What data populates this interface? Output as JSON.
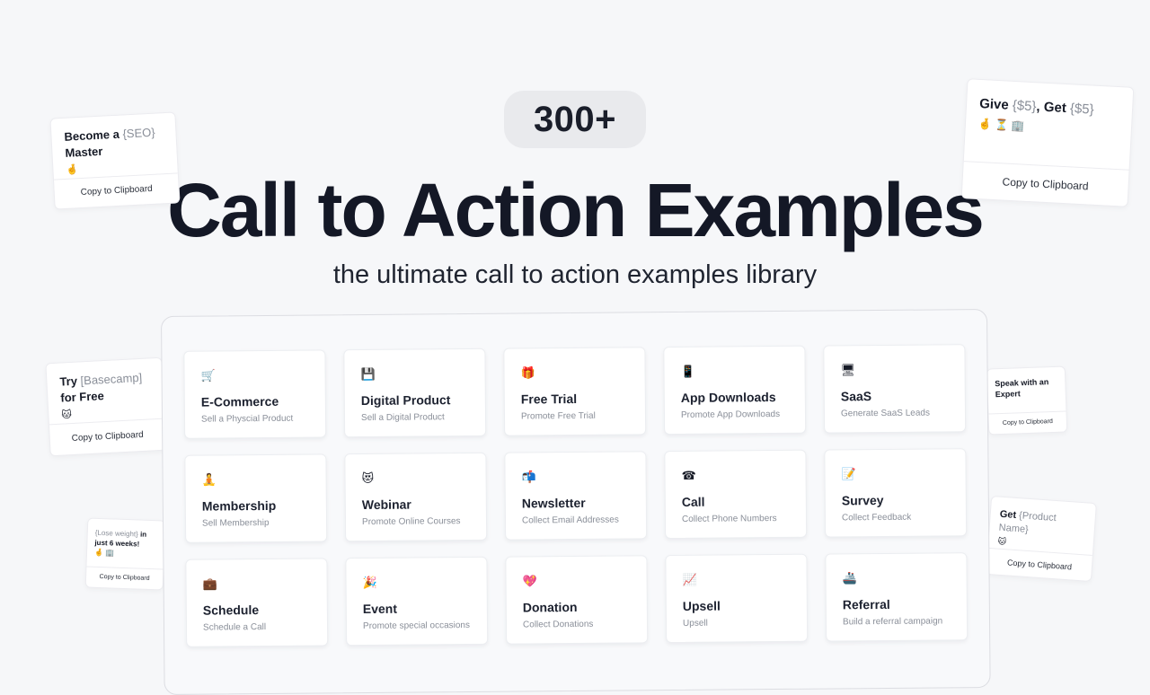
{
  "hero": {
    "badge": "300+",
    "title": "Call to Action Examples",
    "subtitle": "the ultimate call to action examples library"
  },
  "floating_cards": [
    {
      "id": "seo",
      "parts": [
        {
          "t": "Become a ",
          "kind": "bold"
        },
        {
          "t": "{SEO}",
          "kind": "var"
        },
        {
          "t": " Master",
          "kind": "bold"
        }
      ],
      "emoji": "🤞",
      "copy": "Copy to Clipboard"
    },
    {
      "id": "give-get",
      "parts": [
        {
          "t": "Give ",
          "kind": "bold"
        },
        {
          "t": "{$5}",
          "kind": "var"
        },
        {
          "t": ", Get ",
          "kind": "bold"
        },
        {
          "t": "{$5}",
          "kind": "var"
        }
      ],
      "emoji": "🤞 ⏳ 🏢",
      "copy": "Copy to Clipboard"
    },
    {
      "id": "basecamp",
      "parts": [
        {
          "t": "Try ",
          "kind": "bold"
        },
        {
          "t": "[Basecamp]",
          "kind": "var"
        },
        {
          "t": " for Free",
          "kind": "bold"
        }
      ],
      "emoji": "🐱",
      "copy": "Copy to Clipboard"
    },
    {
      "id": "expert",
      "parts": [
        {
          "t": "Speak with an Expert",
          "kind": "bold"
        }
      ],
      "emoji": "",
      "copy": "Copy to Clipboard"
    },
    {
      "id": "lose-weight",
      "parts": [
        {
          "t": "{Lose weight}",
          "kind": "var"
        },
        {
          "t": " in just 6 weeks!",
          "kind": "bold"
        }
      ],
      "emoji": "🤞 🏢",
      "copy": "Copy to Clipboard"
    },
    {
      "id": "product",
      "parts": [
        {
          "t": "Get ",
          "kind": "bold"
        },
        {
          "t": "{Product Name}",
          "kind": "var"
        }
      ],
      "emoji": "🐱",
      "copy": "Copy to Clipboard"
    }
  ],
  "categories": [
    {
      "icon": "🛒",
      "icon_name": "shopping-cart-icon",
      "title": "E-Commerce",
      "desc": "Sell a Physcial Product"
    },
    {
      "icon": "💾",
      "icon_name": "floppy-disk-icon",
      "title": "Digital Product",
      "desc": "Sell a Digital Product"
    },
    {
      "icon": "🎁",
      "icon_name": "gift-icon",
      "title": "Free Trial",
      "desc": "Promote Free Trial"
    },
    {
      "icon": "📱",
      "icon_name": "mobile-phone-icon",
      "title": "App Downloads",
      "desc": "Promote App Downloads"
    },
    {
      "icon": "🖥",
      "icon_name": "desktop-computer-icon",
      "title": "SaaS",
      "desc": "Generate SaaS Leads"
    },
    {
      "icon": "🧘",
      "icon_name": "meditation-icon",
      "title": "Membership",
      "desc": "Sell Membership"
    },
    {
      "icon": "😻",
      "icon_name": "cat-face-icon",
      "title": "Webinar",
      "desc": "Promote Online Courses"
    },
    {
      "icon": "📬",
      "icon_name": "mailbox-icon",
      "title": "Newsletter",
      "desc": "Collect Email Addresses"
    },
    {
      "icon": "☎",
      "icon_name": "telephone-icon",
      "title": "Call",
      "desc": "Collect Phone Numbers"
    },
    {
      "icon": "📝",
      "icon_name": "memo-icon",
      "title": "Survey",
      "desc": "Collect Feedback"
    },
    {
      "icon": "💼",
      "icon_name": "briefcase-icon",
      "title": "Schedule",
      "desc": "Schedule a Call"
    },
    {
      "icon": "🎉",
      "icon_name": "party-icon",
      "title": "Event",
      "desc": "Promote special occasions"
    },
    {
      "icon": "💖",
      "icon_name": "heart-icon",
      "title": "Donation",
      "desc": "Collect Donations"
    },
    {
      "icon": "📈",
      "icon_name": "chart-increasing-icon",
      "title": "Upsell",
      "desc": "Upsell"
    },
    {
      "icon": "🚢",
      "icon_name": "ship-icon",
      "title": "Referral",
      "desc": "Build a referral campaign"
    }
  ]
}
